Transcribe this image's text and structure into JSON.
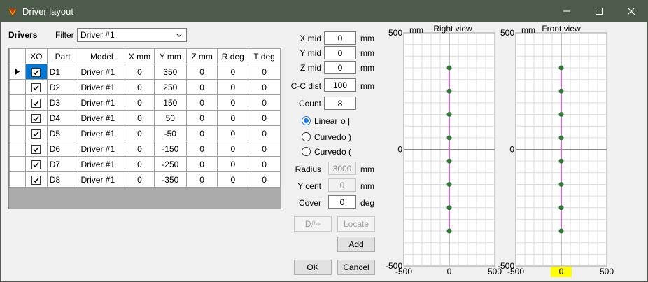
{
  "window": {
    "title": "Driver layout"
  },
  "drivers": {
    "heading": "Drivers",
    "filter_label": "Filter",
    "filter_value": "Driver #1",
    "columns": [
      "XO",
      "Part",
      "Model",
      "X mm",
      "Y mm",
      "Z mm",
      "R deg",
      "T deg"
    ],
    "rows": [
      {
        "xo": true,
        "part": "D1",
        "model": "Driver #1",
        "x": "0",
        "y": "350",
        "z": "0",
        "r": "0",
        "t": "0"
      },
      {
        "xo": true,
        "part": "D2",
        "model": "Driver #1",
        "x": "0",
        "y": "250",
        "z": "0",
        "r": "0",
        "t": "0"
      },
      {
        "xo": true,
        "part": "D3",
        "model": "Driver #1",
        "x": "0",
        "y": "150",
        "z": "0",
        "r": "0",
        "t": "0"
      },
      {
        "xo": true,
        "part": "D4",
        "model": "Driver #1",
        "x": "0",
        "y": "50",
        "z": "0",
        "r": "0",
        "t": "0"
      },
      {
        "xo": true,
        "part": "D5",
        "model": "Driver #1",
        "x": "0",
        "y": "-50",
        "z": "0",
        "r": "0",
        "t": "0"
      },
      {
        "xo": true,
        "part": "D6",
        "model": "Driver #1",
        "x": "0",
        "y": "-150",
        "z": "0",
        "r": "0",
        "t": "0"
      },
      {
        "xo": true,
        "part": "D7",
        "model": "Driver #1",
        "x": "0",
        "y": "-250",
        "z": "0",
        "r": "0",
        "t": "0"
      },
      {
        "xo": true,
        "part": "D8",
        "model": "Driver #1",
        "x": "0",
        "y": "-350",
        "z": "0",
        "r": "0",
        "t": "0"
      }
    ]
  },
  "layout": {
    "x_mid_label": "X mid",
    "x_mid": "0",
    "x_mid_unit": "mm",
    "y_mid_label": "Y mid",
    "y_mid": "0",
    "y_mid_unit": "mm",
    "z_mid_label": "Z mid",
    "z_mid": "0",
    "z_mid_unit": "mm",
    "cc_label": "C-C dist",
    "cc": "100",
    "cc_unit": "mm",
    "count_label": "Count",
    "count": "8",
    "linear_label": "Linear",
    "linear_glyph": "o |",
    "curved1_label": "Curved",
    "curved1_glyph": "o )",
    "curved2_label": "Curved",
    "curved2_glyph": "o (",
    "radius_label": "Radius",
    "radius": "3000",
    "radius_unit": "mm",
    "ycent_label": "Y cent",
    "ycent": "0",
    "ycent_unit": "mm",
    "cover_label": "Cover",
    "cover": "0",
    "cover_unit": "deg"
  },
  "buttons": {
    "dplus": "D#+",
    "locate": "Locate",
    "add": "Add",
    "ok": "OK",
    "cancel": "Cancel"
  },
  "chart_data": [
    {
      "type": "scatter",
      "title": "Right view",
      "unit_label": "mm",
      "xlim": [
        -500,
        500
      ],
      "ylim": [
        -500,
        500
      ],
      "x_ticks": [
        "-500",
        "0",
        "500"
      ],
      "y_ticks": [
        "500",
        "0",
        "-500"
      ],
      "points": [
        [
          0,
          350
        ],
        [
          0,
          250
        ],
        [
          0,
          150
        ],
        [
          0,
          50
        ],
        [
          0,
          -50
        ],
        [
          0,
          -150
        ],
        [
          0,
          -250
        ],
        [
          0,
          -350
        ]
      ],
      "grid": true,
      "point_color": "#2e7d32",
      "line_color": "#cc33cc"
    },
    {
      "type": "scatter",
      "title": "Front view",
      "unit_label": "mm",
      "xlim": [
        -500,
        500
      ],
      "ylim": [
        -500,
        500
      ],
      "x_ticks": [
        "-500",
        "0",
        "500"
      ],
      "y_ticks": [
        "500",
        "0",
        "-500"
      ],
      "highlighted_tick": "0",
      "points": [
        [
          0,
          350
        ],
        [
          0,
          250
        ],
        [
          0,
          150
        ],
        [
          0,
          50
        ],
        [
          0,
          -50
        ],
        [
          0,
          -150
        ],
        [
          0,
          -250
        ],
        [
          0,
          -350
        ]
      ],
      "grid": true,
      "point_color": "#2e7d32",
      "line_color": "#cc33cc"
    }
  ]
}
